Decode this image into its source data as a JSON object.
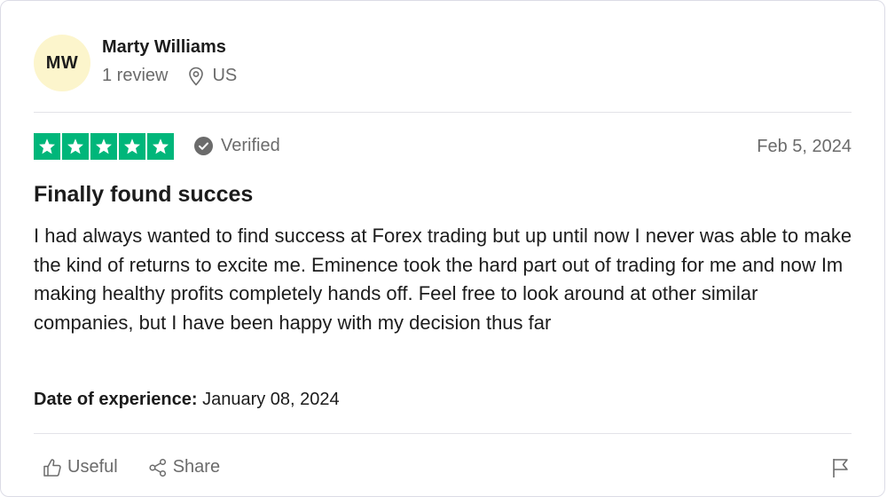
{
  "reviewer": {
    "initials": "MW",
    "name": "Marty Williams",
    "review_count": "1 review",
    "country": "US",
    "avatar_color": "#fcf5cc"
  },
  "rating": {
    "stars": 5,
    "max": 5,
    "star_color": "#00b67a",
    "verified_label": "Verified"
  },
  "review": {
    "date": "Feb 5, 2024",
    "title": "Finally found succes",
    "body": "I had always wanted to find success at Forex trading but up until now I never was able to make the kind of returns to excite me. Eminence took the hard part out of trading for me and now Im making healthy profits completely hands off. Feel free to look around at other similar companies, but I have been happy with my decision thus far",
    "experience_label": "Date of experience:",
    "experience_date": "January 08, 2024"
  },
  "actions": {
    "useful_label": "Useful",
    "share_label": "Share"
  },
  "icons": {
    "location": "location-pin-icon",
    "verified": "check-circle-icon",
    "useful": "thumbs-up-icon",
    "share": "share-icon",
    "flag": "flag-icon"
  }
}
